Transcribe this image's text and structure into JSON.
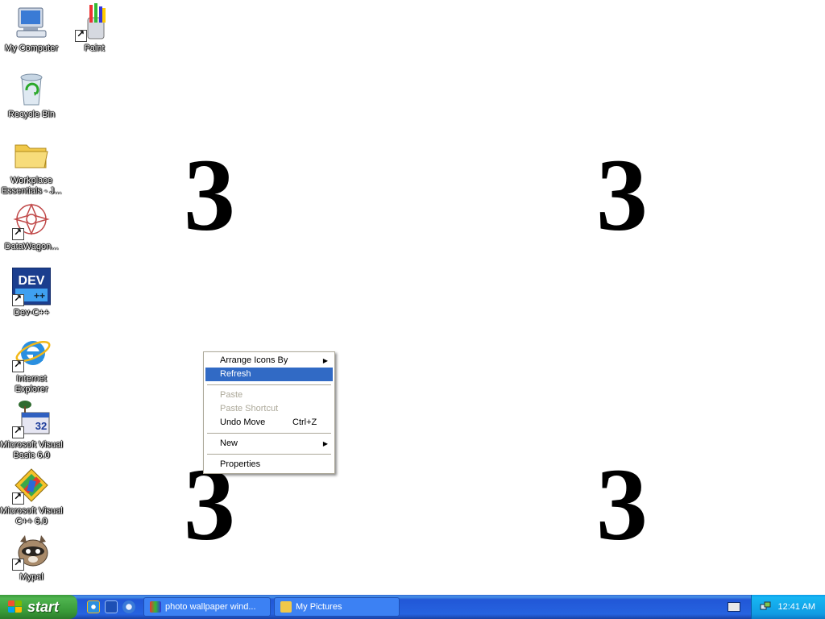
{
  "wallpaper": {
    "numerals": [
      "3",
      "3",
      "3",
      "3"
    ]
  },
  "desktop_icons": [
    {
      "label": "My Computer",
      "icon": "my-computer-icon",
      "shortcut": false
    },
    {
      "label": "Paint",
      "icon": "paint-icon",
      "shortcut": true
    },
    {
      "label": "Recycle Bin",
      "icon": "recycle-bin-icon",
      "shortcut": false
    },
    {
      "label": "Workplace Essentials - J...",
      "icon": "folder-icon",
      "shortcut": false
    },
    {
      "label": "DataWagon...",
      "icon": "datawagon-icon",
      "shortcut": true
    },
    {
      "label": "Dev-C++",
      "icon": "dev-cpp-icon",
      "shortcut": true
    },
    {
      "label": "Internet Explorer",
      "icon": "internet-explorer-icon",
      "shortcut": true
    },
    {
      "label": "Microsoft Visual Basic 6.0",
      "icon": "visual-basic-icon",
      "shortcut": true
    },
    {
      "label": "Microsoft Visual C++ 6.0",
      "icon": "visual-cpp-icon",
      "shortcut": true
    },
    {
      "label": "Mypal",
      "icon": "mypal-icon",
      "shortcut": true
    }
  ],
  "dev_icon_text": "DEV",
  "vb_icon_text": "32",
  "context_menu": {
    "items": [
      {
        "label": "Arrange Icons By",
        "submenu": true,
        "state": "normal"
      },
      {
        "label": "Refresh",
        "state": "highlighted"
      },
      {
        "label": "Paste",
        "state": "disabled"
      },
      {
        "label": "Paste Shortcut",
        "state": "disabled"
      },
      {
        "label": "Undo Move",
        "shortcut": "Ctrl+Z",
        "state": "normal"
      },
      {
        "label": "New",
        "submenu": true,
        "state": "normal"
      },
      {
        "label": "Properties",
        "state": "normal"
      }
    ]
  },
  "taskbar": {
    "start_label": "start",
    "quick_launch": [
      "internet-explorer-icon",
      "show-desktop-icon",
      "media-player-icon"
    ],
    "tasks": [
      {
        "label": "photo wallpaper wind...",
        "icon": "paint-icon"
      },
      {
        "label": "My Pictures",
        "icon": "folder-icon"
      }
    ],
    "clock": "12:41 AM"
  },
  "colors": {
    "menu_highlight": "#316ac5",
    "taskbar_blue": "#2663e0",
    "start_green": "#3c9a3c",
    "tray_blue": "#109be3"
  }
}
